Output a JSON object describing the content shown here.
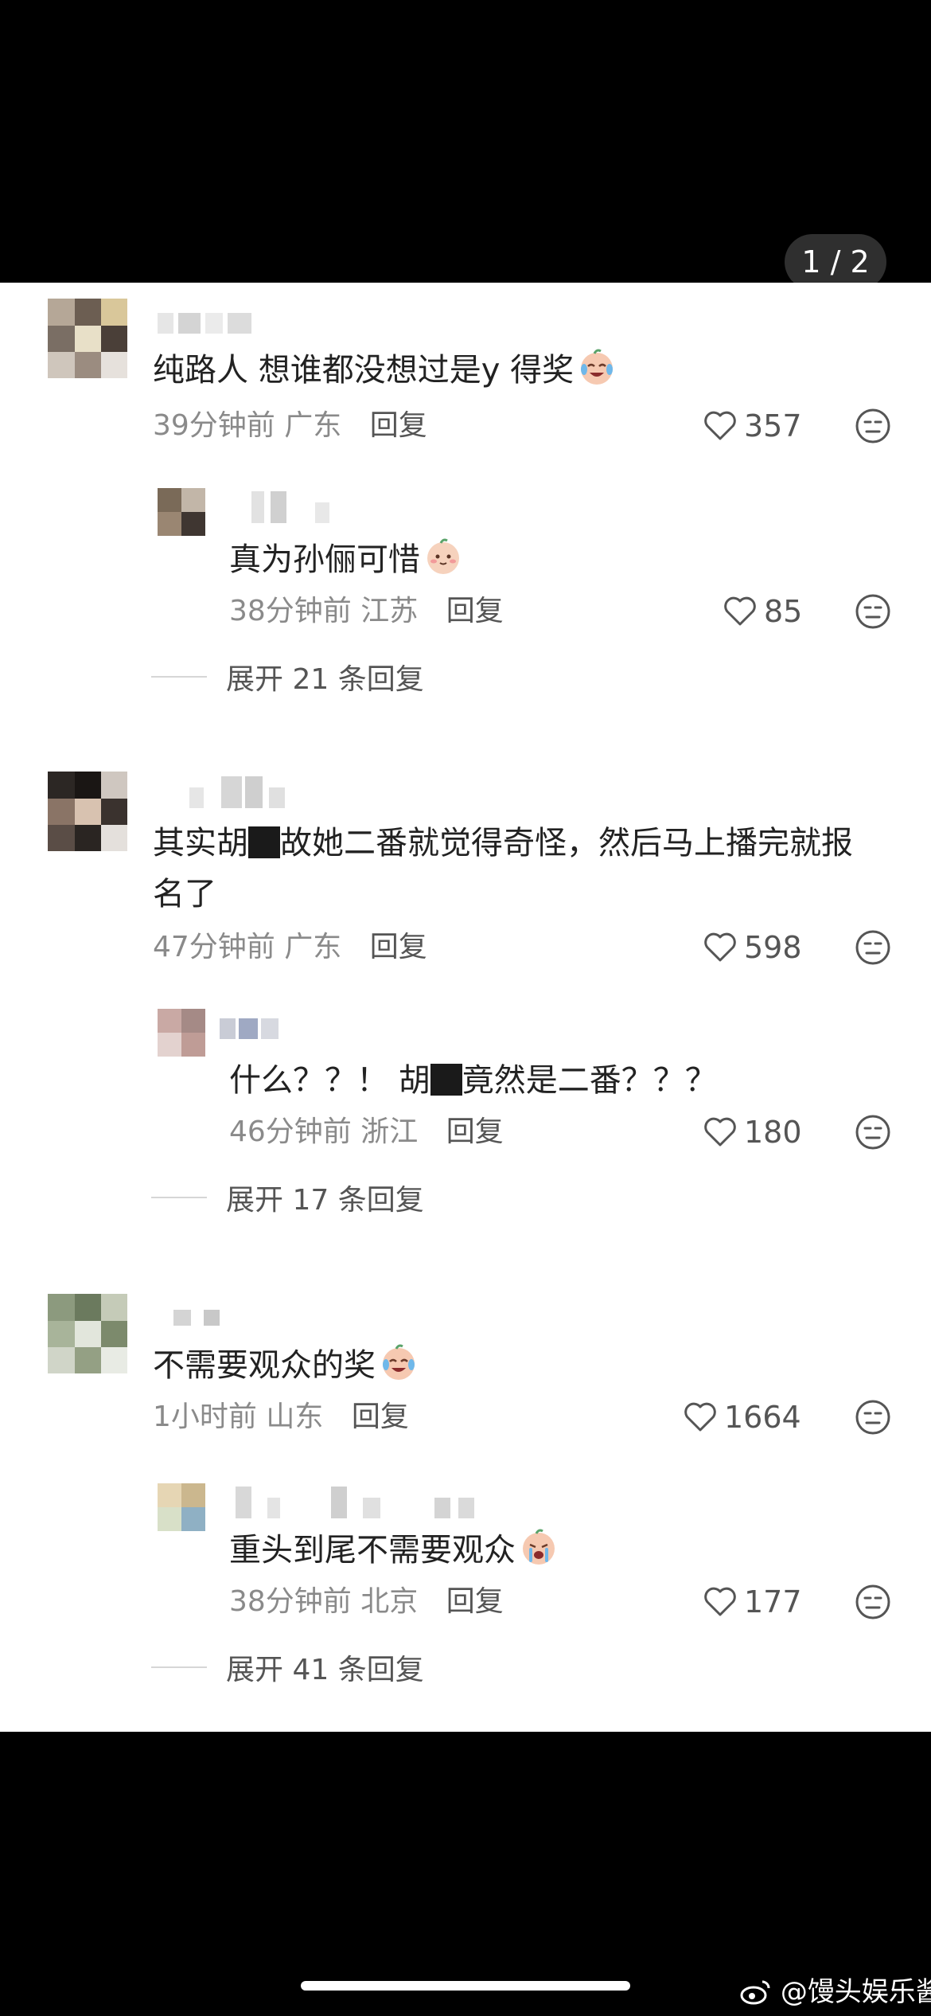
{
  "counter": "1 / 2",
  "comments": [
    {
      "text": "纯路人 想谁都没想过是y 得奖",
      "time": "39分钟前",
      "location": "广东",
      "reply_label": "回复",
      "likes": "357",
      "reply": {
        "text": "真为孙俪可惜",
        "time": "38分钟前",
        "location": "江苏",
        "reply_label": "回复",
        "likes": "85"
      },
      "expand": "展开 21 条回复"
    },
    {
      "text_line1_a": "其实胡",
      "text_line1_b": "故她二番就觉得奇怪，然后马上播完就报",
      "text_line2": "名了",
      "time": "47分钟前",
      "location": "广东",
      "reply_label": "回复",
      "likes": "598",
      "reply": {
        "text_a": "什么？？！ 胡",
        "text_b": "竟然是二番？？？",
        "time": "46分钟前",
        "location": "浙江",
        "reply_label": "回复",
        "likes": "180"
      },
      "expand": "展开 17 条回复"
    },
    {
      "text": "不需要观众的奖",
      "time": "1小时前",
      "location": "山东",
      "reply_label": "回复",
      "likes": "1664",
      "reply": {
        "text": "重头到尾不需要观众",
        "time": "38分钟前",
        "location": "北京",
        "reply_label": "回复",
        "likes": "177"
      },
      "expand": "展开 41 条回复"
    }
  ],
  "watermark": "@馒头娱乐酱",
  "icons": {
    "like": "heart-outline-icon",
    "dislike": "meh-face-icon",
    "emoji_laugh": "laughing-tears-emoji",
    "emoji_shy": "blushing-face-emoji",
    "emoji_cry": "crying-face-emoji",
    "weibo": "weibo-logo-icon"
  }
}
